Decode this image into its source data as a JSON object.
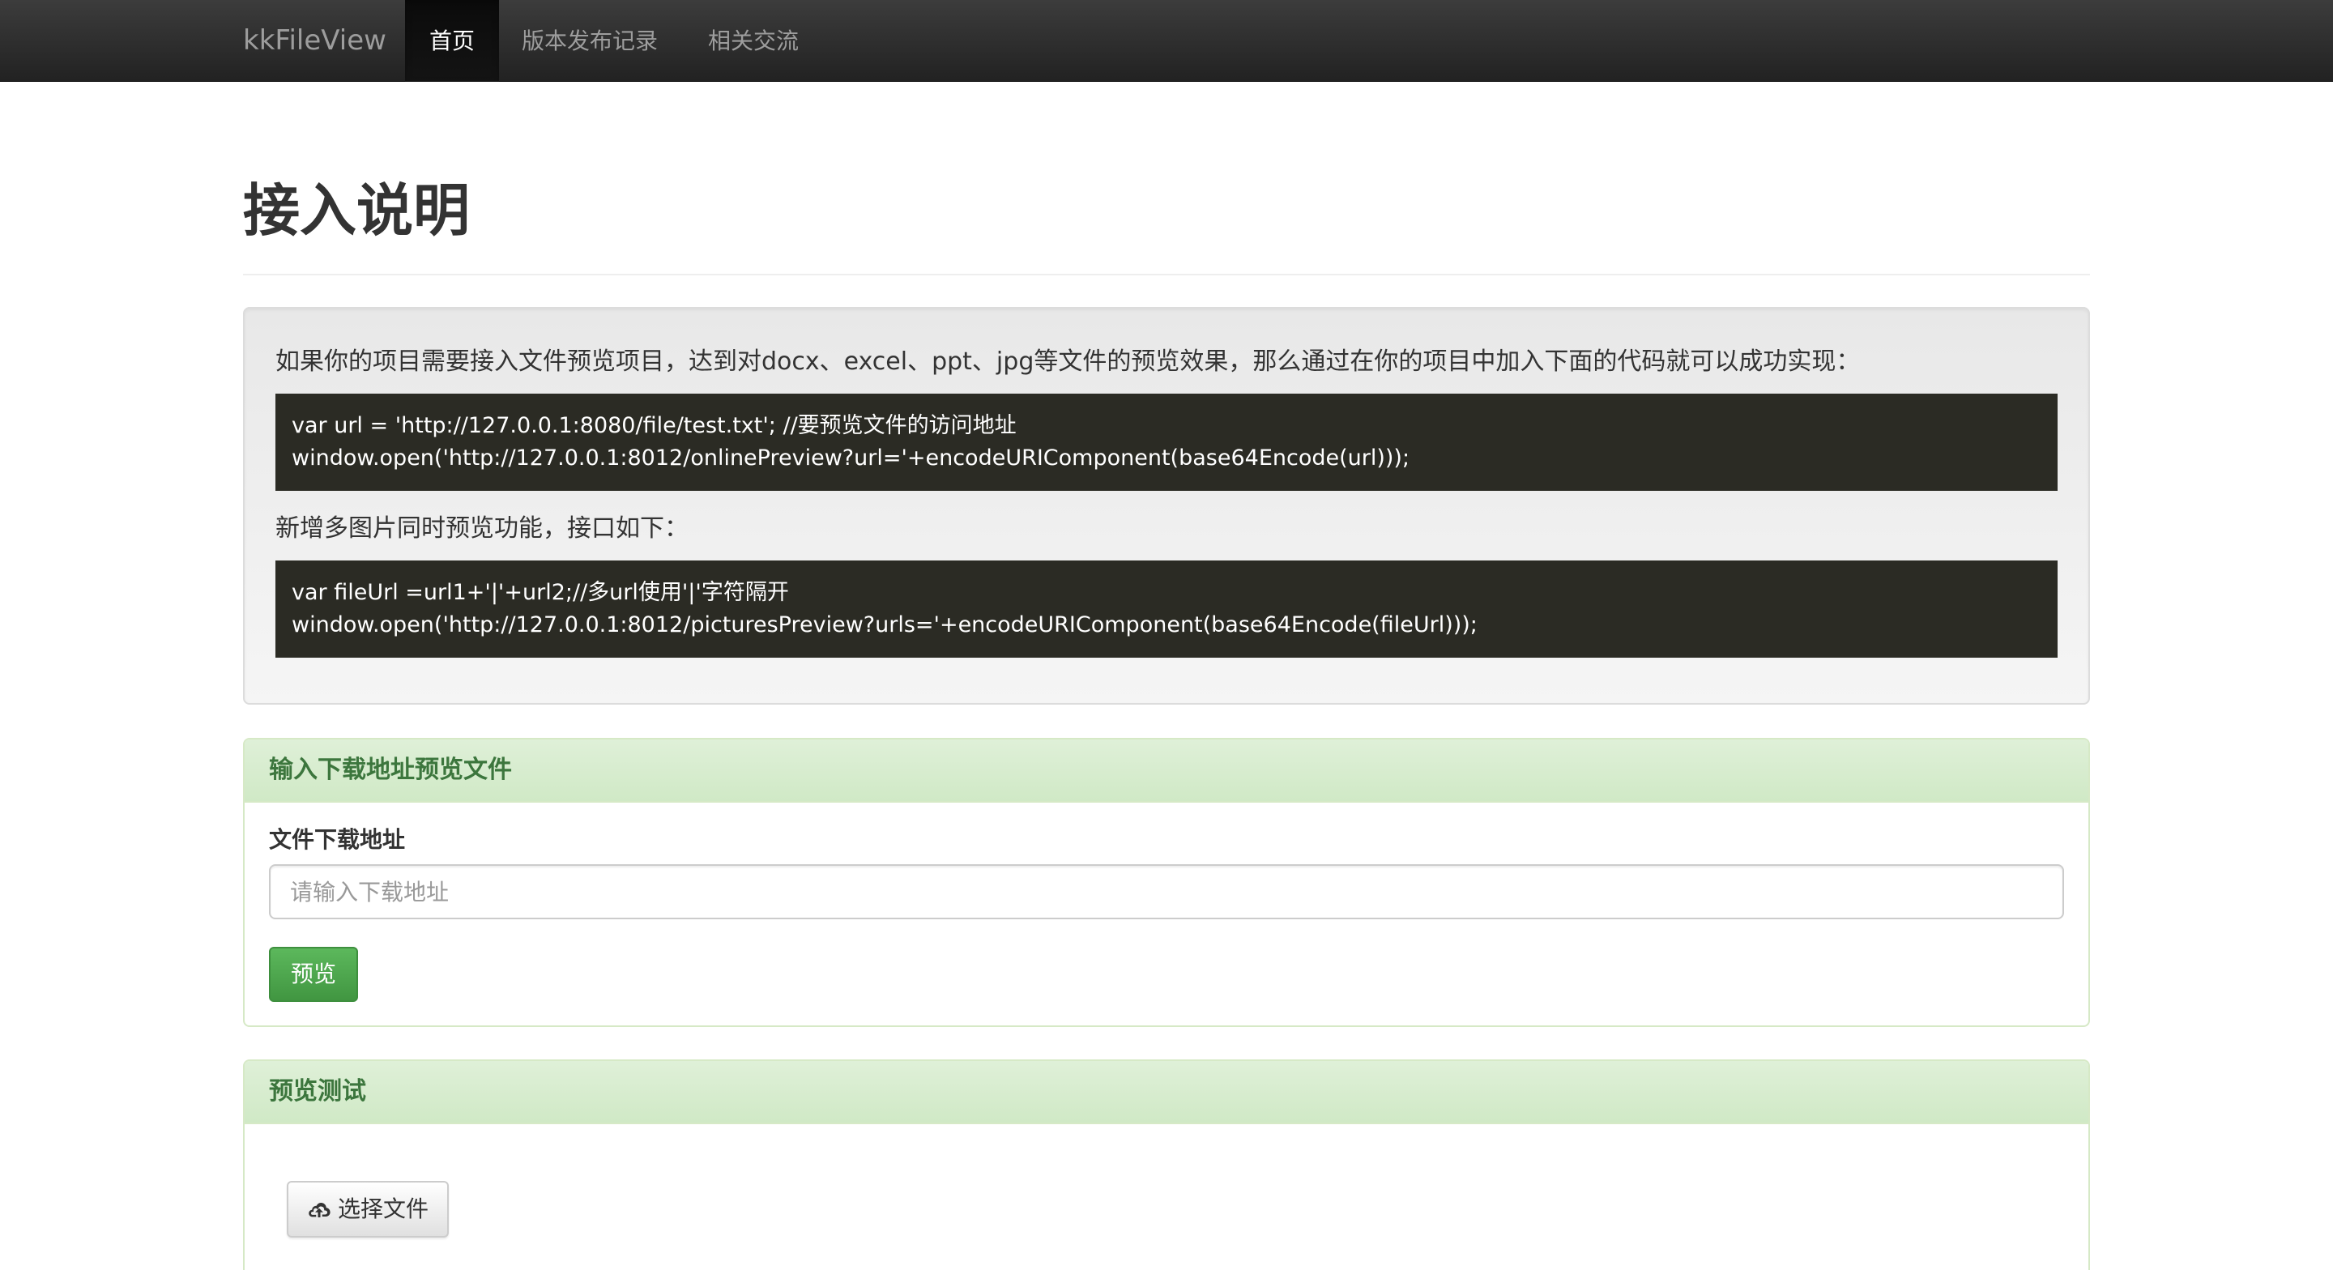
{
  "navbar": {
    "brand": "kkFileView",
    "items": [
      {
        "label": "首页",
        "active": true
      },
      {
        "label": "版本发布记录",
        "active": false
      },
      {
        "label": "相关交流",
        "active": false
      }
    ]
  },
  "page": {
    "title": "接入说明"
  },
  "well": {
    "intro": "如果你的项目需要接入文件预览项目，达到对docx、excel、ppt、jpg等文件的预览效果，那么通过在你的项目中加入下面的代码就可以成功实现：",
    "code1": [
      "var url = 'http://127.0.0.1:8080/file/test.txt'; //要预览文件的访问地址",
      "window.open('http://127.0.0.1:8012/onlinePreview?url='+encodeURIComponent(base64Encode(url)));"
    ],
    "sub": "新增多图片同时预览功能，接口如下：",
    "code2": [
      "var fileUrl =url1+'|'+url2;//多url使用'|'字符隔开",
      "window.open('http://127.0.0.1:8012/picturesPreview?urls='+encodeURIComponent(base64Encode(fileUrl)));"
    ]
  },
  "download_panel": {
    "heading": "输入下载地址预览文件",
    "label": "文件下载地址",
    "placeholder": "请输入下载地址",
    "value": "",
    "button": "预览"
  },
  "test_panel": {
    "heading": "预览测试",
    "upload_button": "选择文件",
    "upload_icon": "cloud-upload-icon"
  },
  "colors": {
    "navbar": "#222222",
    "success": "#5cb85c",
    "panel_heading": "#dff0d8",
    "panel_text": "#3c763d",
    "code_bg": "#2b2b24"
  }
}
